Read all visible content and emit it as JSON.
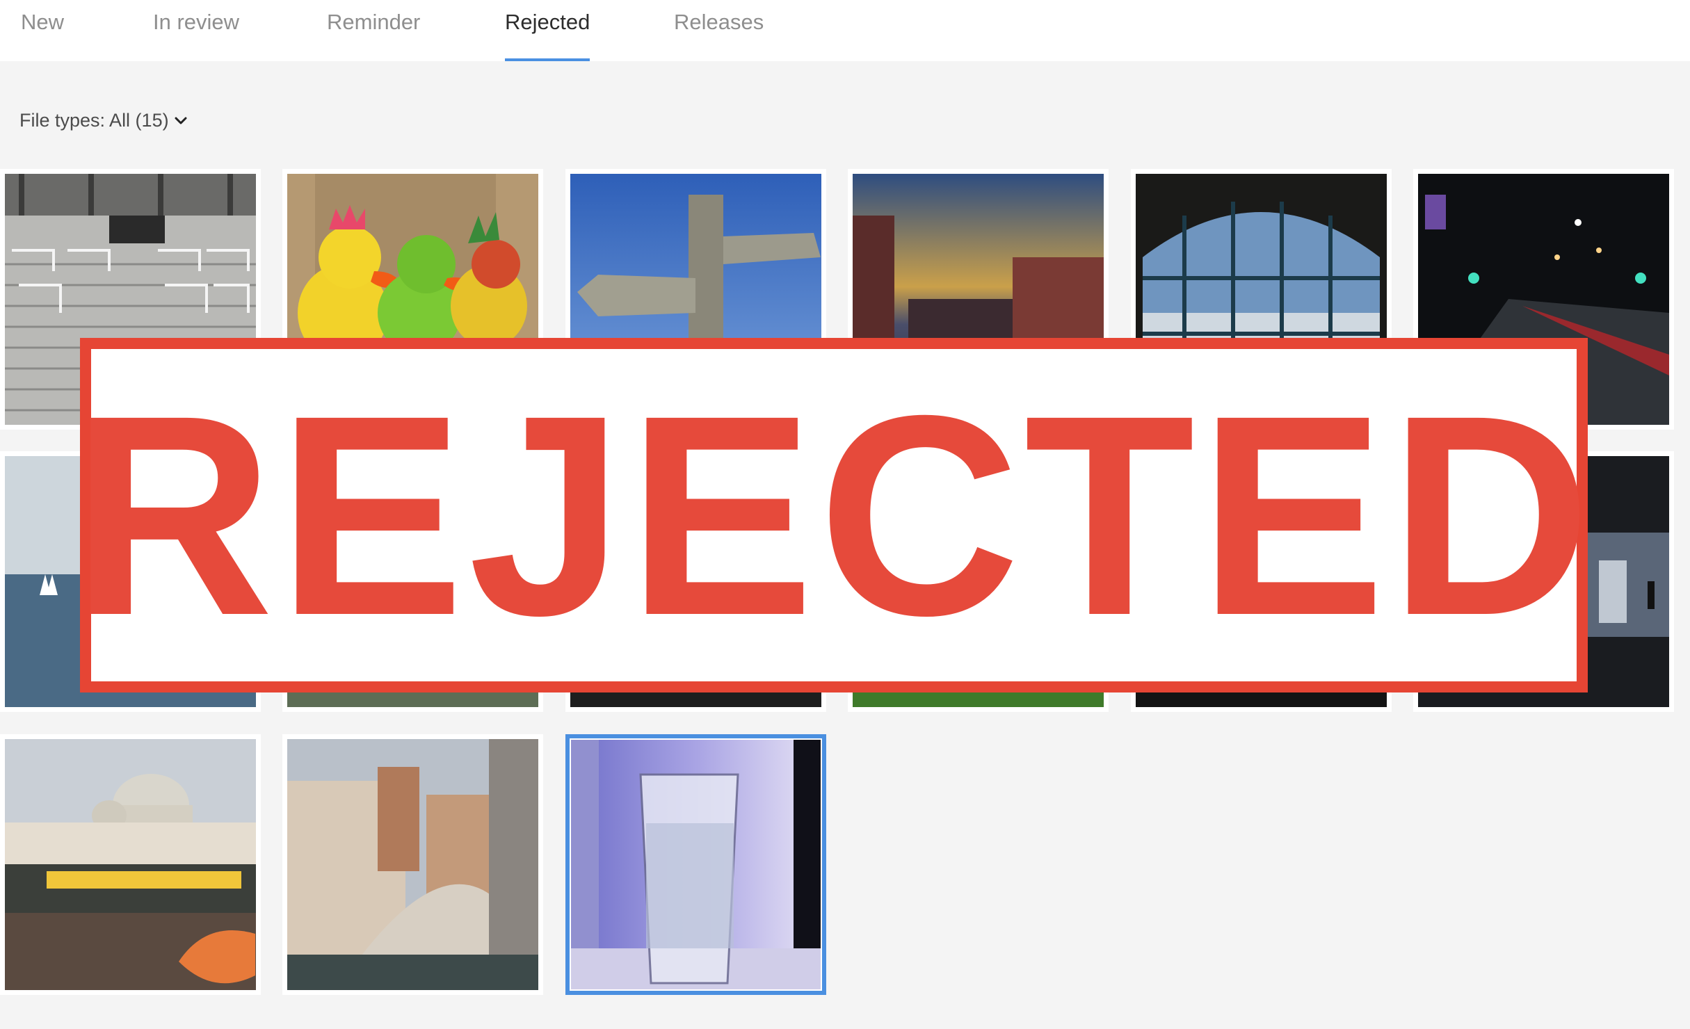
{
  "tabs": [
    {
      "label": "New",
      "active": false
    },
    {
      "label": "In review",
      "active": false
    },
    {
      "label": "Reminder",
      "active": false
    },
    {
      "label": "Rejected",
      "active": true
    },
    {
      "label": "Releases",
      "active": false
    }
  ],
  "filter": {
    "label": "File types: All (15)",
    "icon": "chevron-down-icon"
  },
  "thumbnails": [
    {
      "subject": "stadium-stands"
    },
    {
      "subject": "rubber-ducks"
    },
    {
      "subject": "signpost-holyhead"
    },
    {
      "subject": "dusk-street-buildings"
    },
    {
      "subject": "arched-window-harbor"
    },
    {
      "subject": "night-street-lights"
    },
    {
      "subject": "sailboats-sea"
    },
    {
      "subject": "waterfall"
    },
    {
      "subject": "dark-scene"
    },
    {
      "subject": "grass"
    },
    {
      "subject": "dark-interior"
    },
    {
      "subject": "subway-platform"
    },
    {
      "subject": "venice-salute"
    },
    {
      "subject": "venice-rialto"
    },
    {
      "subject": "glass-of-water",
      "selected": true
    }
  ],
  "stamp": {
    "text": "REJECTED",
    "color": "#e64a3b"
  },
  "colors": {
    "accent": "#4a90e2",
    "background": "#f4f4f4",
    "stamp_red": "#e64534"
  }
}
